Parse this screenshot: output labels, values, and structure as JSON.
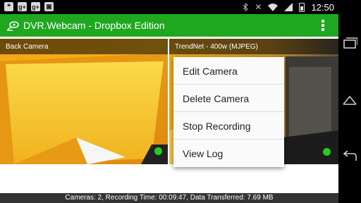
{
  "status_bar": {
    "left_icons": [
      "hangouts-icon",
      "google-plus-icon",
      "google-plus-icon",
      "shopping-bag-icon"
    ],
    "time": "12:50"
  },
  "action_bar": {
    "title": "DVR.Webcam - Dropbox Edition",
    "overflow_icon": "overflow-menu-icon"
  },
  "cameras": [
    {
      "name": "Back Camera",
      "recording": true,
      "status_color": "#22cc22"
    },
    {
      "name": "TrendNet - 400w (MJPEG)",
      "recording": true,
      "status_color": "#22cc22"
    }
  ],
  "popup_menu": {
    "items": [
      "Edit Camera",
      "Delete Camera",
      "Stop Recording",
      "View Log"
    ]
  },
  "info_bar": {
    "text": "Cameras: 2, Recording Time: 00:09:47, Data Transferred: 7.69 MB"
  },
  "nav_bar": {
    "icons": [
      "recents-icon",
      "home-icon",
      "back-icon"
    ]
  },
  "colors": {
    "accent": "#1fa81f",
    "recording": "#22cc22"
  }
}
